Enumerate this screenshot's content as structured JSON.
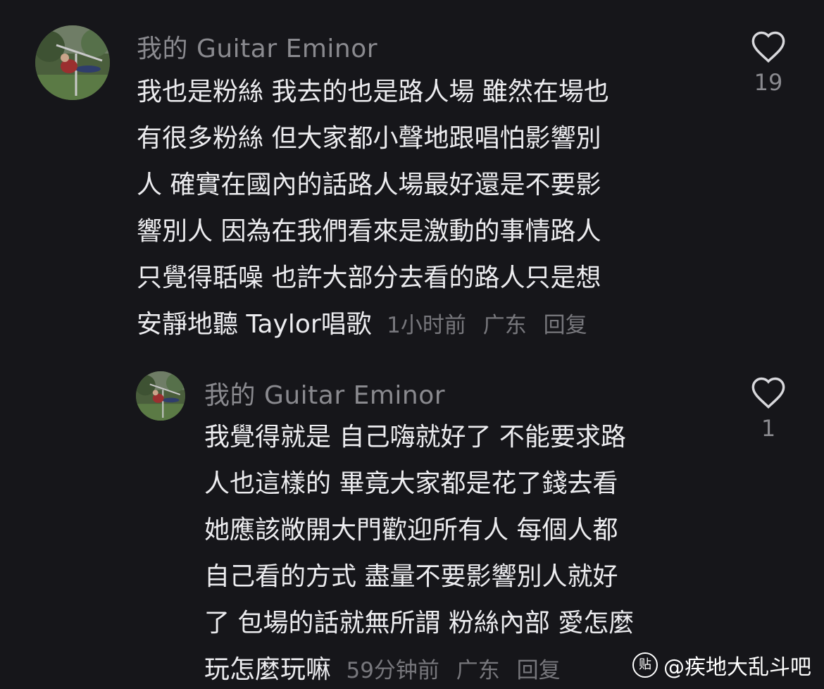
{
  "comments": [
    {
      "username": "我的 Guitar Eminor",
      "lines": [
        "我也是粉絲 我去的也是路人場 雖然在場也",
        "有很多粉絲 但大家都小聲地跟唱怕影響別",
        "人 確實在國內的話路人場最好還是不要影",
        "響別人 因為在我們看來是激動的事情路人",
        "只覺得聒噪 也許大部分去看的路人只是想",
        "安靜地聽 Taylor唱歌"
      ],
      "time": "1小时前",
      "location": "广东",
      "reply_label": "回复",
      "like_count": "19",
      "avatar_icon": "user-avatar-photo"
    },
    {
      "username": "我的 Guitar Eminor",
      "lines": [
        "我覺得就是 自己嗨就好了 不能要求路",
        "人也這樣的 畢竟大家都是花了錢去看",
        "她應該敞開大門歡迎所有人 每個人都",
        "自己看的方式 盡量不要影響別人就好",
        "了 包場的話就無所謂 粉絲內部 愛怎麼",
        "玩怎麼玩嘛"
      ],
      "time": "59分钟前",
      "location": "广东",
      "reply_label": "回复",
      "like_count": "1",
      "avatar_icon": "user-avatar-photo"
    }
  ],
  "watermark": {
    "icon_glyph": "贴",
    "text": "@疾地大乱斗吧"
  },
  "colors": {
    "background": "#16161a",
    "body_text": "#ececef",
    "secondary_text": "#8a8a8f",
    "meta_text": "#77777c"
  }
}
